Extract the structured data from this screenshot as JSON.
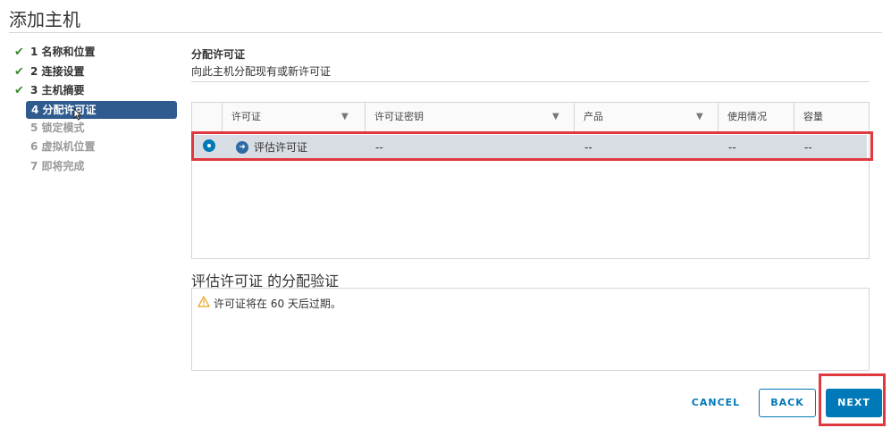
{
  "page": {
    "title": "添加主机"
  },
  "steps": [
    {
      "label": "1 名称和位置",
      "state": "done"
    },
    {
      "label": "2 连接设置",
      "state": "done"
    },
    {
      "label": "3 主机摘要",
      "state": "done"
    },
    {
      "label": "4 分配许可证",
      "state": "active"
    },
    {
      "label": "5 锁定模式",
      "state": "pending"
    },
    {
      "label": "6 虚拟机位置",
      "state": "pending"
    },
    {
      "label": "7 即将完成",
      "state": "pending"
    }
  ],
  "panel": {
    "heading": "分配许可证",
    "subtitle": "向此主机分配现有或新许可证"
  },
  "grid": {
    "columns": [
      "许可证",
      "许可证密钥",
      "产品",
      "使用情况",
      "容量"
    ],
    "filter_icon": "funnel-icon",
    "rows": [
      {
        "selected": true,
        "license": "评估许可证",
        "key": "--",
        "product": "--",
        "usage": "--",
        "capacity": "--"
      }
    ]
  },
  "validation": {
    "heading": "评估许可证 的分配验证",
    "message": "许可证将在 60 天后过期。",
    "icon": "warning-icon"
  },
  "buttons": {
    "cancel": "CANCEL",
    "back": "BACK",
    "next": "NEXT"
  },
  "colors": {
    "accent": "#0079b8",
    "active_step": "#2f5b8f",
    "check": "#3c8a2e",
    "highlight": "#e0383f",
    "selected_row": "#d8dde3"
  }
}
